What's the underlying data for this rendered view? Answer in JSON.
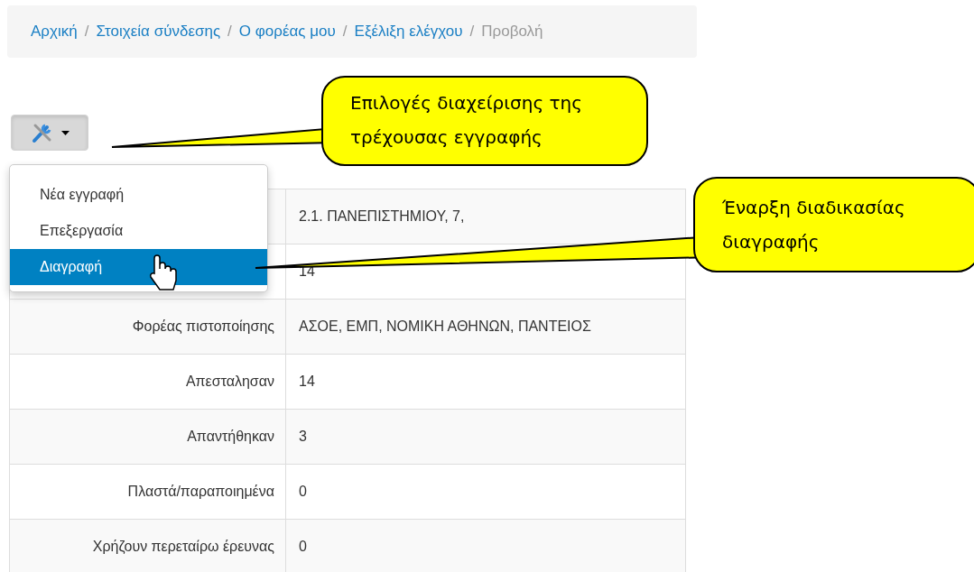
{
  "breadcrumb": [
    {
      "label": "Αρχική",
      "current": false
    },
    {
      "label": "Στοιχεία σύνδεσης",
      "current": false
    },
    {
      "label": "Ο φορέας μου",
      "current": false
    },
    {
      "label": "Εξέλιξη ελέγχου",
      "current": false
    },
    {
      "label": "Προβολή",
      "current": true
    }
  ],
  "separator": "/",
  "tools_menu": {
    "expanded": true,
    "items": [
      {
        "label": "Νέα εγγραφή",
        "selected": false
      },
      {
        "label": "Επεξεργασία",
        "selected": false
      },
      {
        "label": "Διαγραφή",
        "selected": true
      }
    ]
  },
  "table": {
    "rows": [
      {
        "value": "2.1. ΠΑΝΕΠΙΣΤΗΜΙΟΥ, 7,"
      },
      {
        "value": "14"
      },
      {
        "label": "Φορέας πιστοποίησης",
        "value": "ΑΣΟΕ, ΕΜΠ, ΝΟΜΙΚΗ ΑΘΗΝΩΝ, ΠΑΝΤΕΙΟΣ"
      },
      {
        "label": "Απεσταλησαν",
        "value": "14"
      },
      {
        "label": "Απαντήθηκαν",
        "value": "3"
      },
      {
        "label": "Πλαστά/παραποιημένα",
        "value": "0"
      },
      {
        "label": "Χρήζουν περεταίρω έρευνας",
        "value": "0"
      }
    ]
  },
  "callouts": [
    {
      "text": "Επιλογές διαχείρισης της τρέχουσας εγγραφής"
    },
    {
      "text": "Έναρξη διαδικασίας διαγραφής"
    }
  ]
}
